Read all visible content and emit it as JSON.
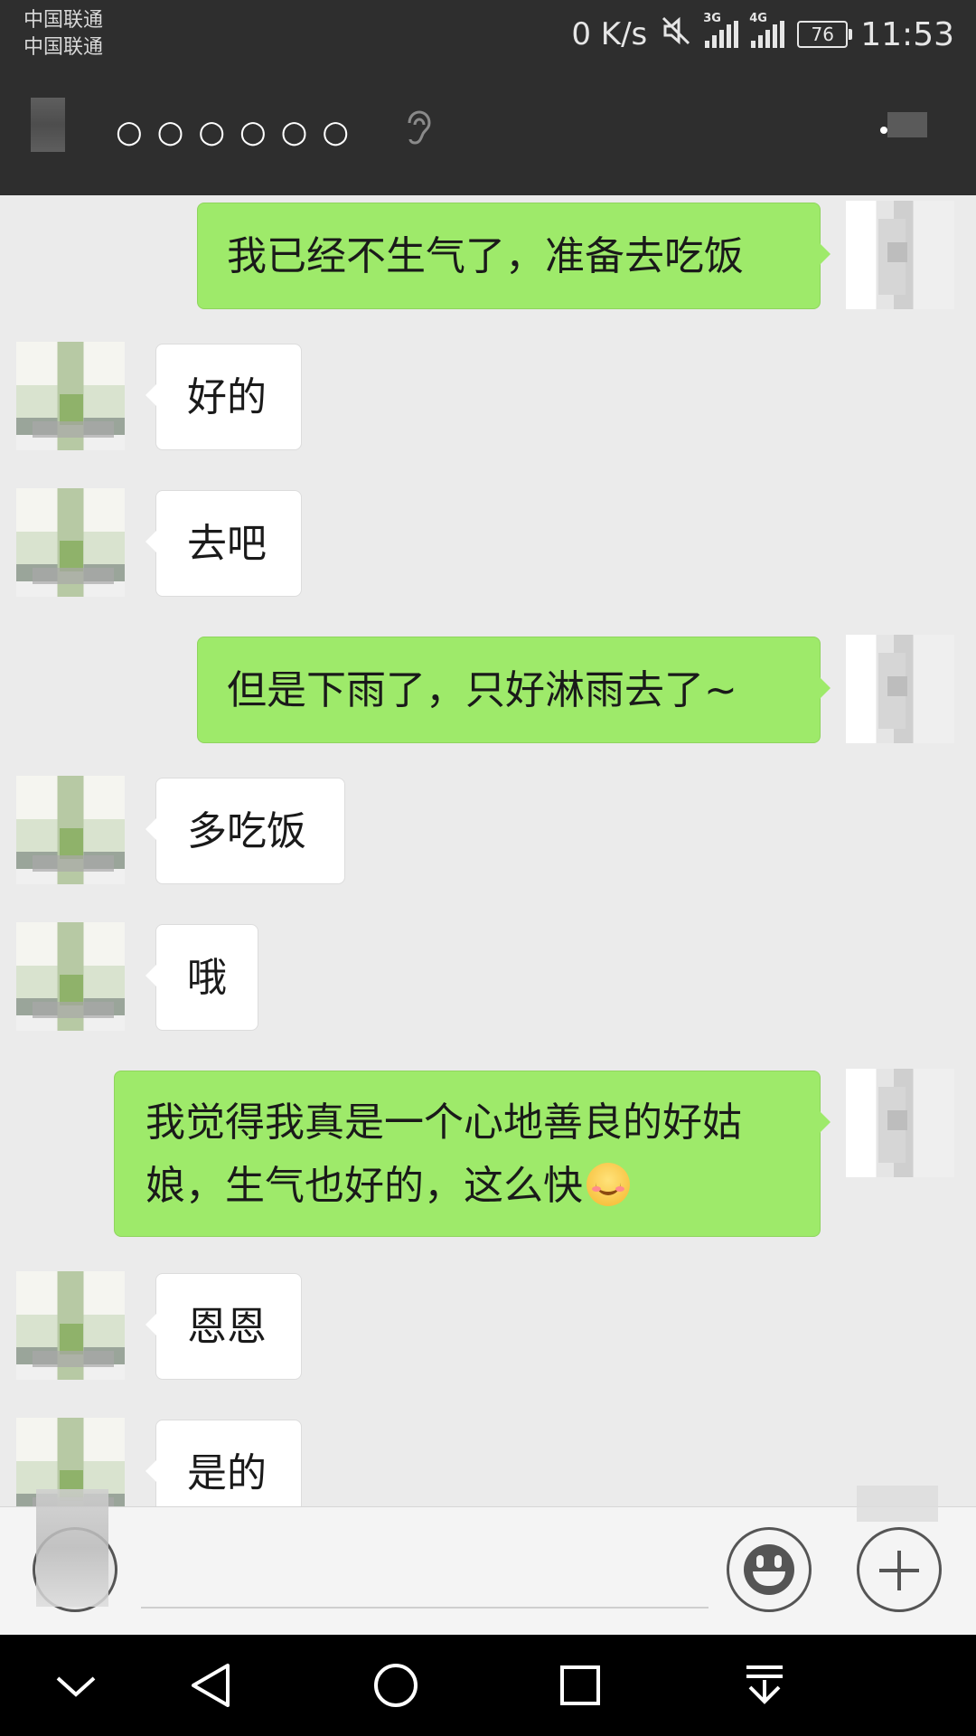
{
  "status_bar": {
    "carrier_1": "中国联通",
    "carrier_2": "中国联通",
    "net_speed": "0 K/s",
    "signal_1_tag": "3G",
    "signal_2_tag": "4G",
    "battery": "76",
    "time": "11:53",
    "icons": [
      "mute-icon",
      "signal-3g-icon",
      "signal-4g-icon",
      "battery-icon"
    ]
  },
  "title_bar": {
    "title": "○○○○○○",
    "icons": [
      "back-icon",
      "earpiece-icon",
      "more-icon"
    ]
  },
  "messages": [
    {
      "sender": "self",
      "text": "我已经不生气了，准备去吃饭"
    },
    {
      "sender": "peer",
      "text": "好的"
    },
    {
      "sender": "peer",
      "text": "去吧"
    },
    {
      "sender": "self",
      "text": "但是下雨了，只好淋雨去了~"
    },
    {
      "sender": "peer",
      "text": "多吃饭"
    },
    {
      "sender": "peer",
      "text": "哦"
    },
    {
      "sender": "self",
      "text_line1": "我觉得我真是一个心地善良的好姑",
      "text_line2": "娘，生气也好的，这么快",
      "emoji": "smile-emoji"
    },
    {
      "sender": "peer",
      "text": "恩恩"
    },
    {
      "sender": "peer",
      "text": "是的"
    }
  ],
  "input_bar": {
    "placeholder": "",
    "icons": [
      "voice-icon",
      "emoji-icon",
      "plus-icon"
    ]
  },
  "nav_bar": {
    "icons": [
      "collapse-icon",
      "back-triangle-icon",
      "home-circle-icon",
      "recents-square-icon",
      "notification-pull-icon"
    ]
  },
  "colors": {
    "status_bg": "#2e2e2e",
    "chat_bg": "#ebebeb",
    "self_bubble": "#9eea6a",
    "peer_bubble": "#ffffff",
    "nav_bg": "#000000"
  }
}
